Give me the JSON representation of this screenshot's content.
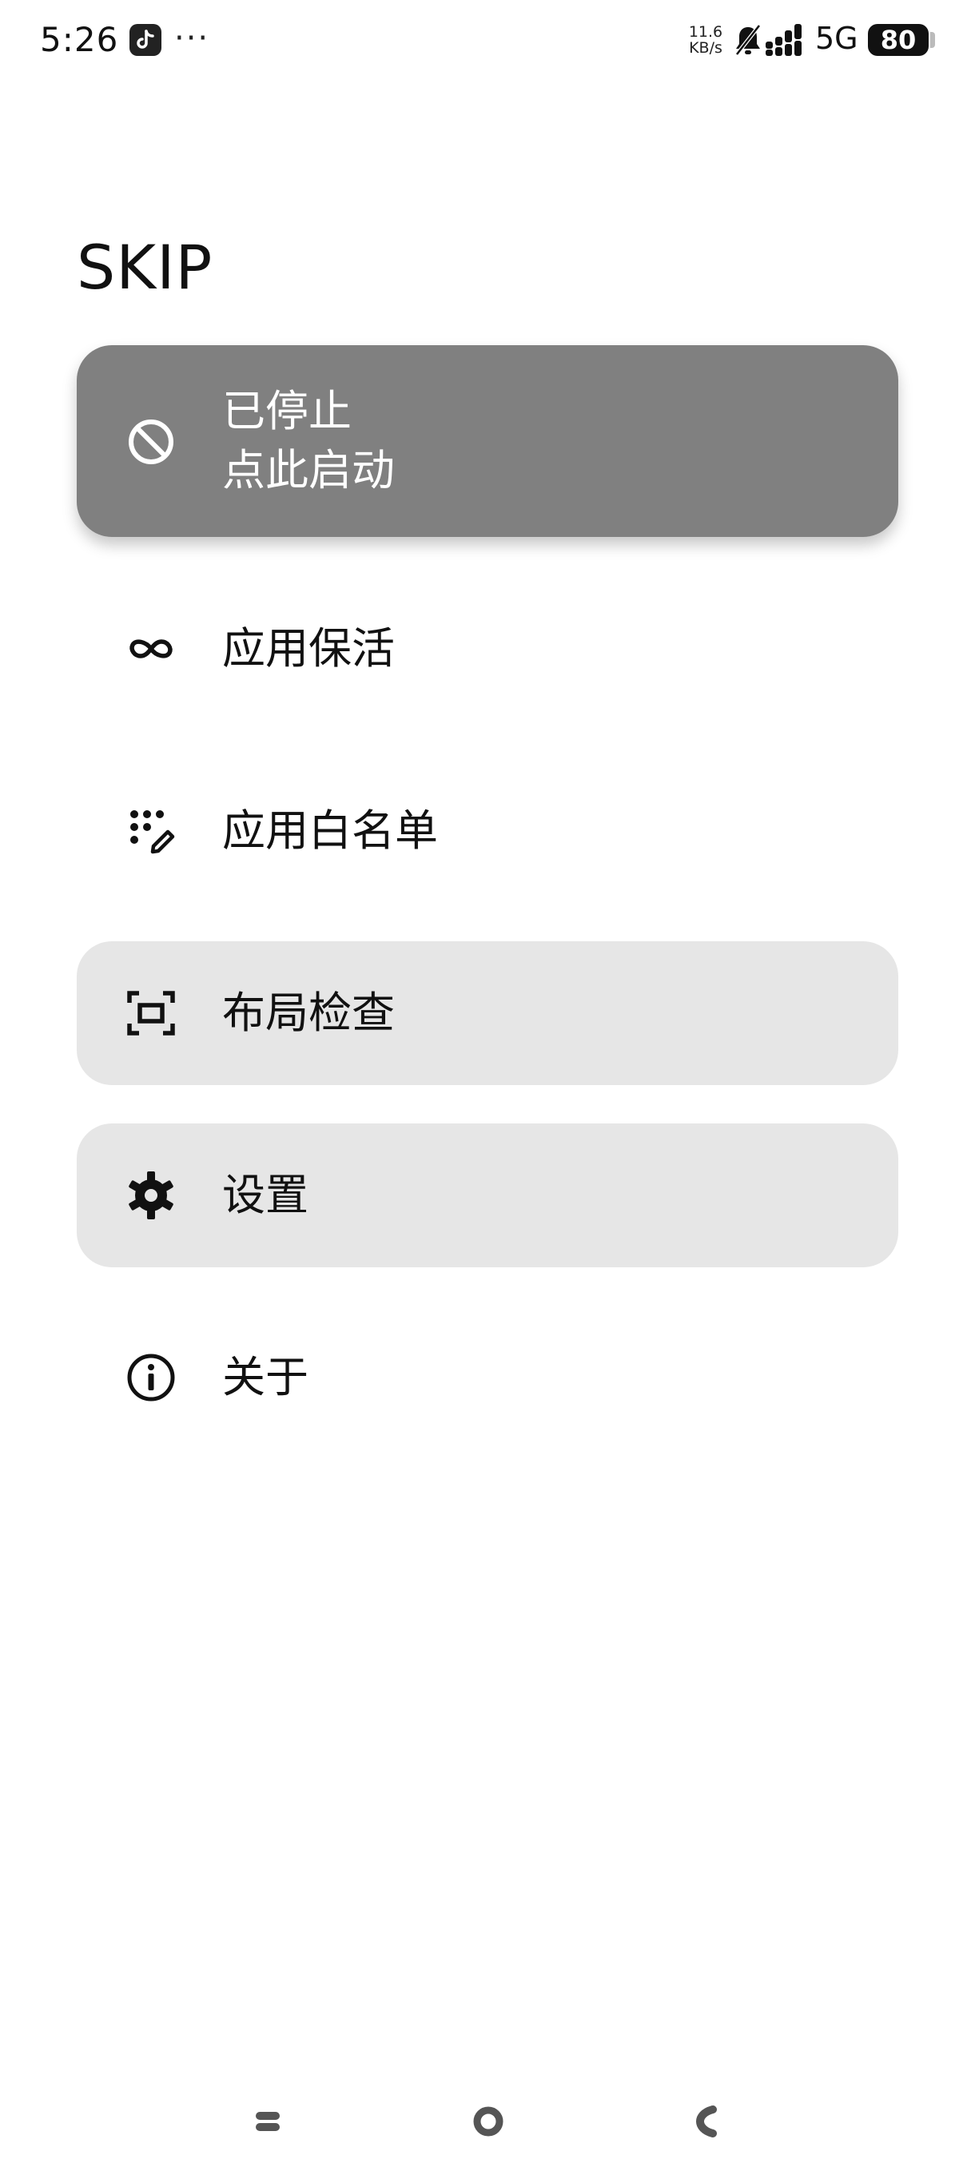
{
  "status_bar": {
    "time": "5:26",
    "more": "···",
    "speed_value": "11.6",
    "speed_unit": "KB/s",
    "network": "5G",
    "battery": "80",
    "icons": [
      "tiktok-icon",
      "bell-muted-icon",
      "signal-icon",
      "battery-icon"
    ]
  },
  "app": {
    "title": "SKIP"
  },
  "status_card": {
    "line1": "已停止",
    "line2": "点此启动",
    "icon": "block-icon",
    "background": "#808080"
  },
  "menu": {
    "items": [
      {
        "label": "应用保活",
        "icon": "infinity-icon"
      },
      {
        "label": "应用白名单",
        "icon": "dots-edit-icon"
      },
      {
        "label": "布局检查",
        "icon": "screen-frame-icon"
      },
      {
        "label": "设置",
        "icon": "gear-icon"
      },
      {
        "label": "关于",
        "icon": "info-icon"
      }
    ]
  },
  "colors": {
    "accent_card": "#808080",
    "item_highlight": "#e6e6e6",
    "text": "#111111"
  },
  "nav_bar": {
    "icons": [
      "menu-nav-icon",
      "home-nav-icon",
      "back-nav-icon"
    ]
  }
}
